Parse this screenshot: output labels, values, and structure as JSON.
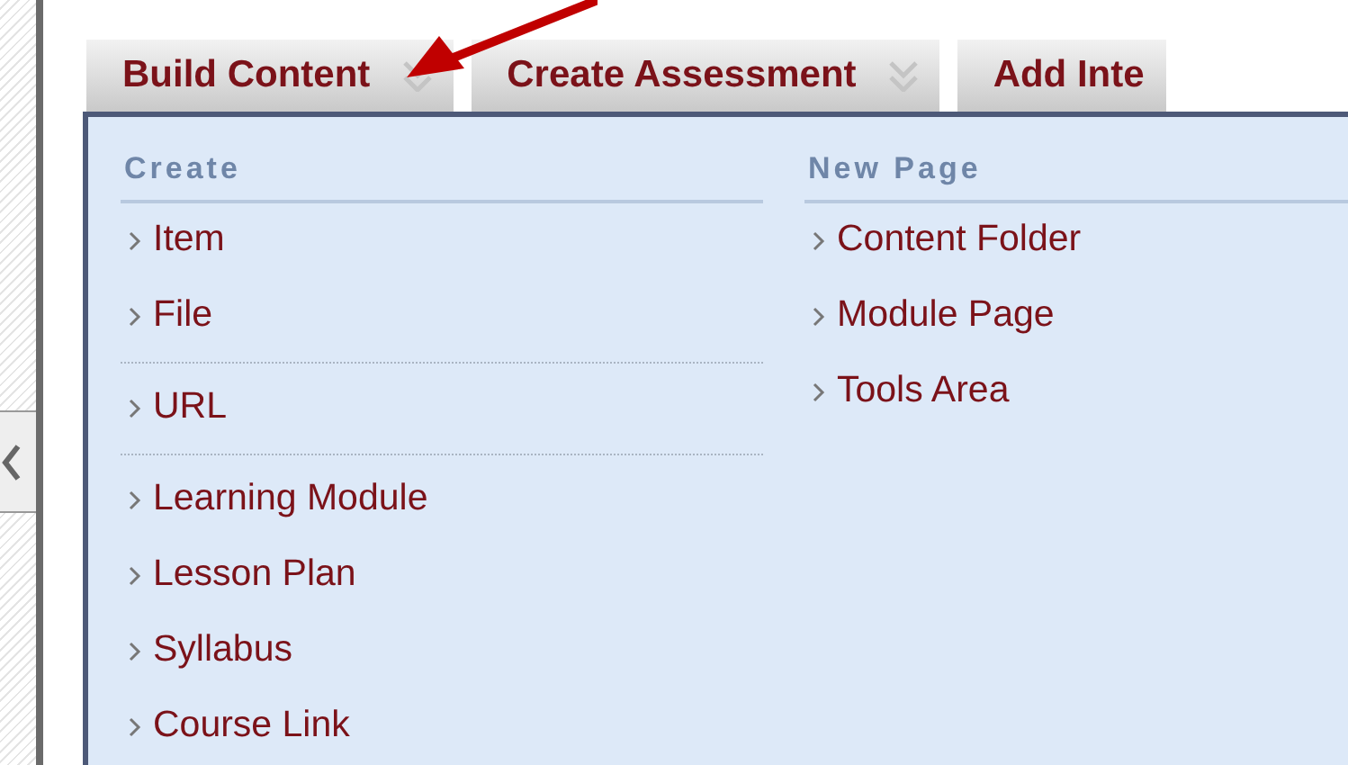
{
  "tabs": [
    {
      "label": "Build Content",
      "chevron": true
    },
    {
      "label": "Create Assessment",
      "chevron": true
    },
    {
      "label": "Add Inte",
      "chevron": false
    }
  ],
  "menu": {
    "columns": [
      {
        "heading": "Create",
        "groups": [
          [
            "Item",
            "File"
          ],
          [
            "URL"
          ],
          [
            "Learning Module",
            "Lesson Plan",
            "Syllabus",
            "Course Link"
          ]
        ]
      },
      {
        "heading": "New Page",
        "groups": [
          [
            "Content Folder",
            "Module Page",
            "Tools Area"
          ]
        ]
      }
    ]
  }
}
